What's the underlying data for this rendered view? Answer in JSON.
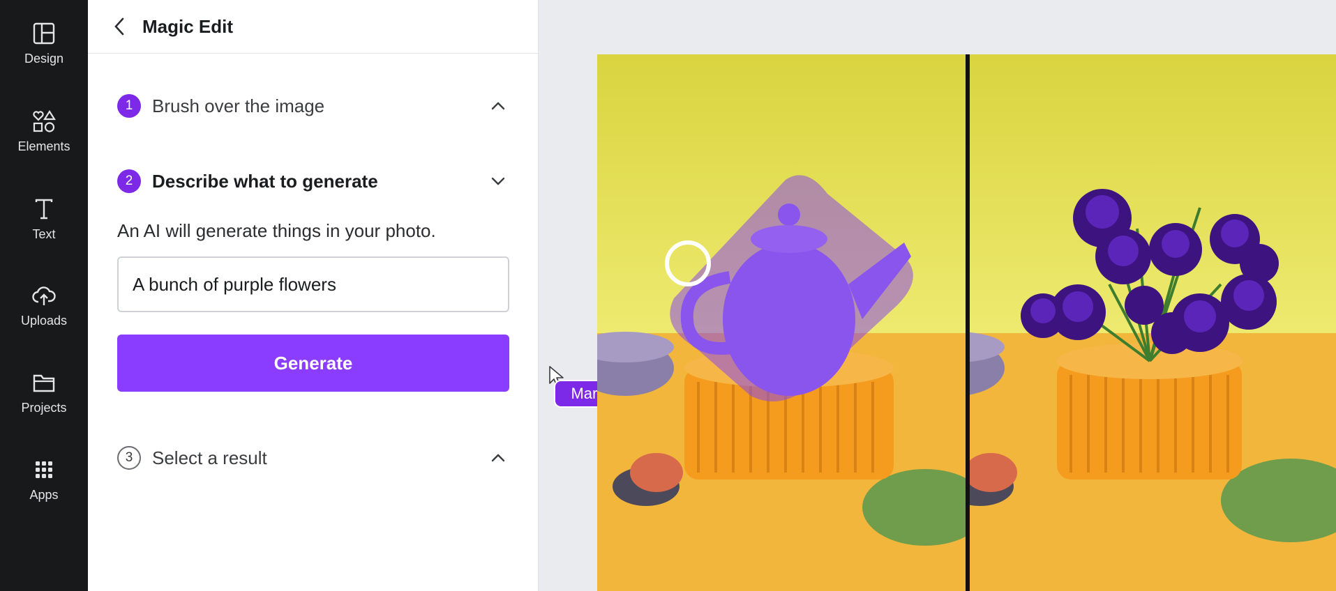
{
  "sidebar": {
    "items": [
      {
        "label": "Design",
        "icon": "layout-icon"
      },
      {
        "label": "Elements",
        "icon": "shapes-icon"
      },
      {
        "label": "Text",
        "icon": "text-icon"
      },
      {
        "label": "Uploads",
        "icon": "cloud-upload-icon"
      },
      {
        "label": "Projects",
        "icon": "folder-icon"
      },
      {
        "label": "Apps",
        "icon": "grid-icon"
      }
    ]
  },
  "panel": {
    "title": "Magic Edit",
    "steps": [
      {
        "number": "1",
        "label": "Brush over the image"
      },
      {
        "number": "2",
        "label": "Describe what to generate"
      },
      {
        "number": "3",
        "label": "Select a result"
      }
    ],
    "helper_text": "An AI will generate things in your photo.",
    "prompt_value": "A bunch of purple flowers",
    "generate_label": "Generate",
    "collaborator_name": "Mario"
  },
  "colors": {
    "accent": "#8b3dff",
    "step_badge": "#7d2ae8",
    "rail_bg": "#18191b",
    "brush": "#8a48e8"
  }
}
